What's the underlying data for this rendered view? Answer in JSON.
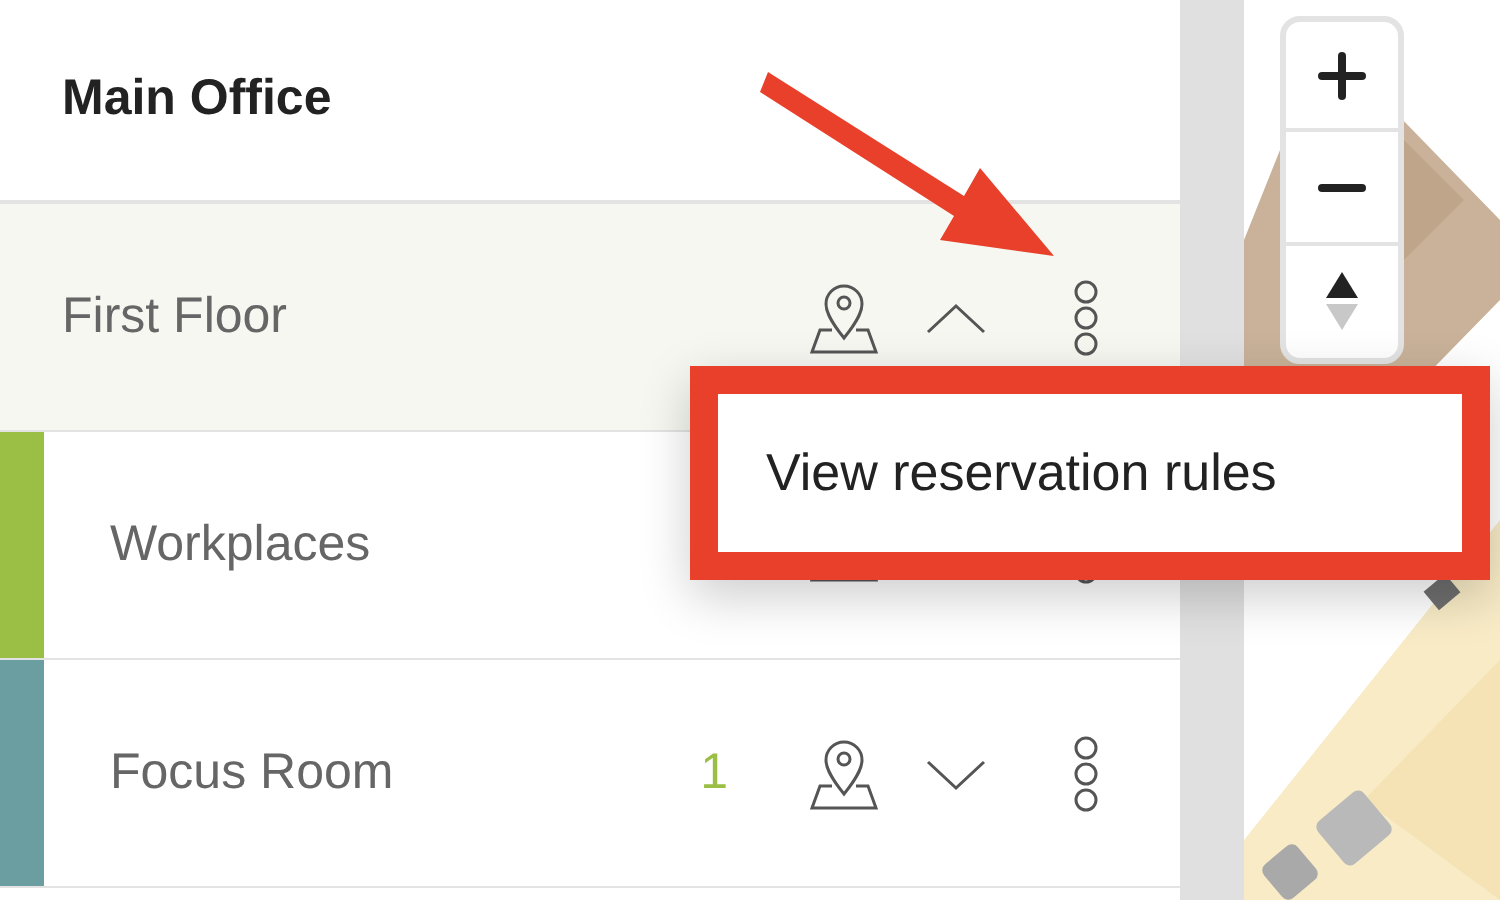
{
  "header": {
    "title": "Main Office"
  },
  "floor": {
    "name": "First Floor",
    "expanded": true,
    "areas": [
      {
        "name": "Workplaces",
        "color": "#9bbf45"
      },
      {
        "name": "Focus Room",
        "count": "1",
        "color": "#6b9ea0",
        "expanded": false
      }
    ]
  },
  "menu": {
    "items": [
      "View reservation rules"
    ]
  }
}
